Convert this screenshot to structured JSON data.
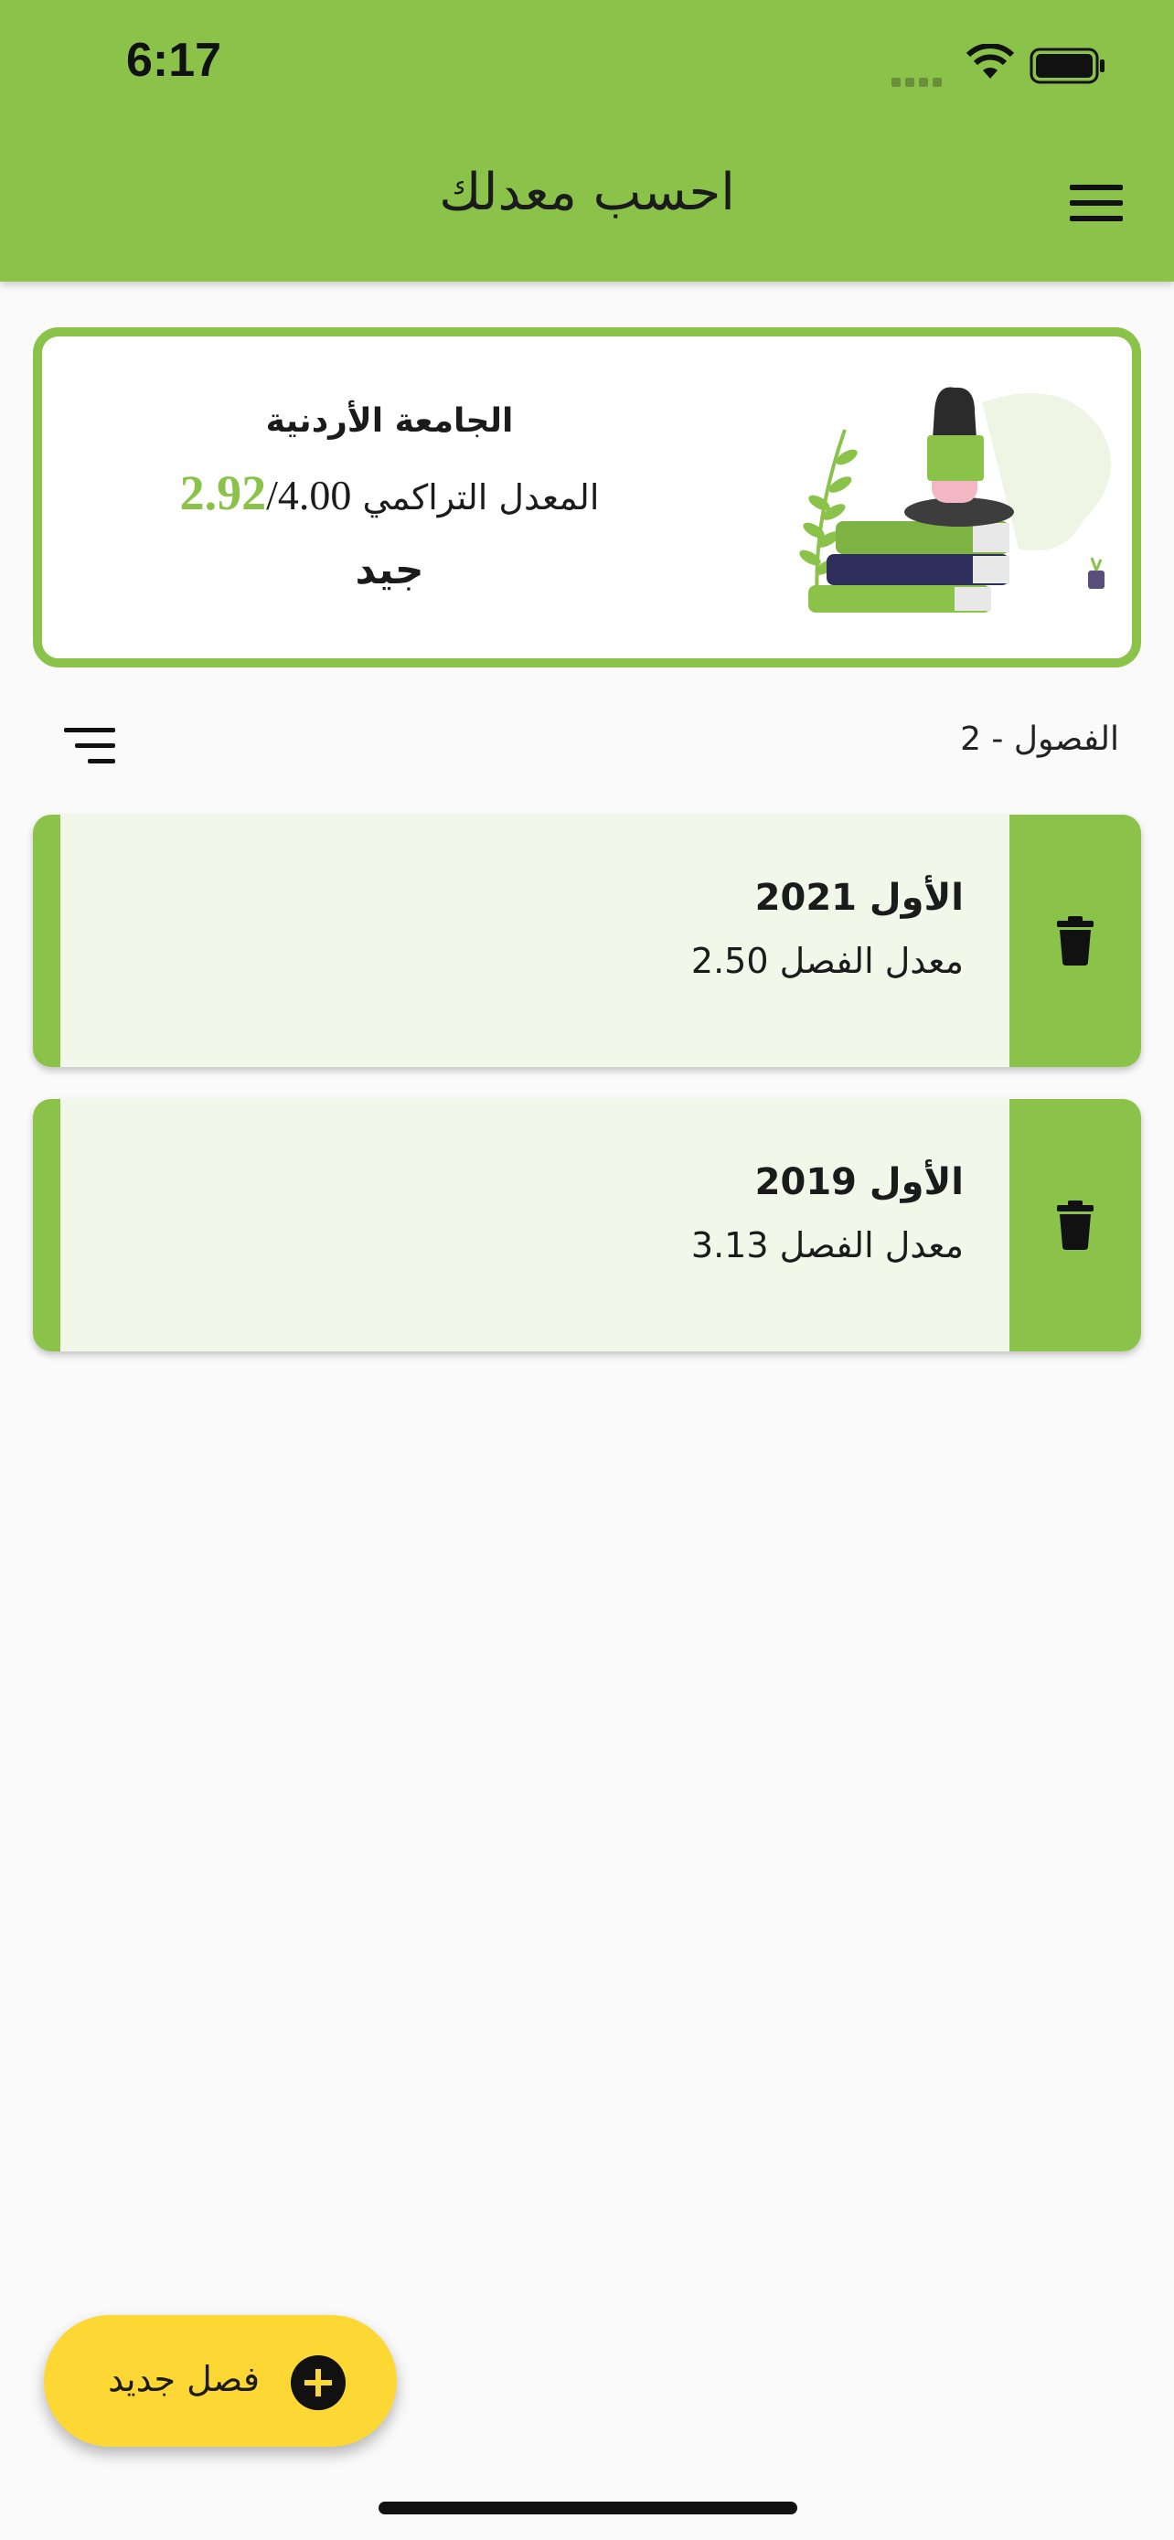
{
  "status_bar": {
    "time": "6:17"
  },
  "app_bar": {
    "title": "احسب معدلك",
    "menu_icon": "menu-icon"
  },
  "summary": {
    "university": "الجامعة الأردنية",
    "gpa_label": "المعدل التراكمي",
    "gpa_max": "4.00",
    "gpa_separator": "/",
    "gpa_value": "2.92",
    "grade": "جيد",
    "accent_color": "#8bc34a"
  },
  "list_header": {
    "count_label": "الفصول - 2",
    "sort_icon": "sort-icon"
  },
  "semesters": [
    {
      "name": "الأول 2021",
      "gpa_label": "معدل الفصل 2.50"
    },
    {
      "name": "الأول 2019",
      "gpa_label": "معدل الفصل 3.13"
    }
  ],
  "fab": {
    "label": "فصل جديد",
    "icon": "add-circle-icon",
    "color": "#fdd835"
  }
}
